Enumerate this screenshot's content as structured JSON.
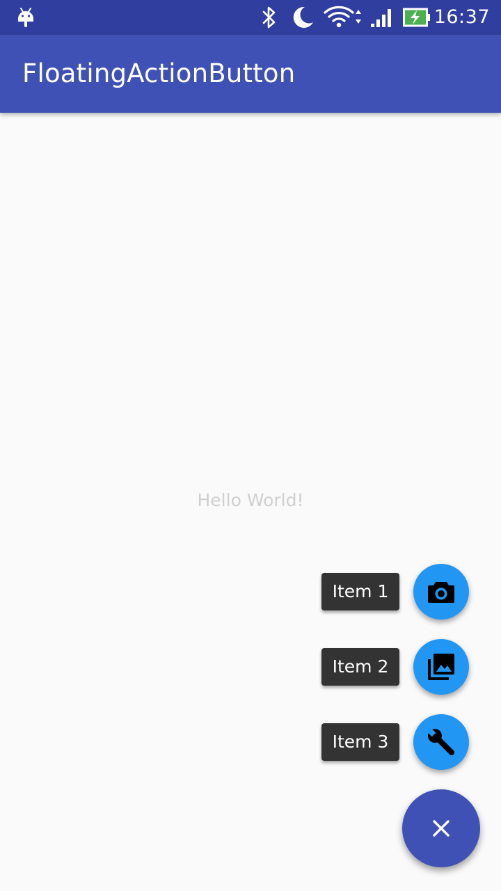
{
  "status_bar": {
    "time": "16:37",
    "icons": [
      "android-icon",
      "bluetooth-icon",
      "moon-icon",
      "wifi-icon",
      "signal-icon",
      "battery-charging-icon"
    ],
    "colors": {
      "background": "#303f9f",
      "battery_fill": "#4caf50"
    }
  },
  "app_bar": {
    "title": "FloatingActionButton",
    "color": "#3f51b5"
  },
  "content": {
    "text": "Hello World!"
  },
  "fab_menu": {
    "items": [
      {
        "label": "Item 1",
        "icon": "camera-icon"
      },
      {
        "label": "Item 2",
        "icon": "photo-library-icon"
      },
      {
        "label": "Item 3",
        "icon": "wrench-icon"
      }
    ],
    "mini_fab_color": "#2196f3",
    "label_color": "#333333",
    "main_fab": {
      "icon": "close-icon",
      "color": "#3f51b5"
    }
  }
}
